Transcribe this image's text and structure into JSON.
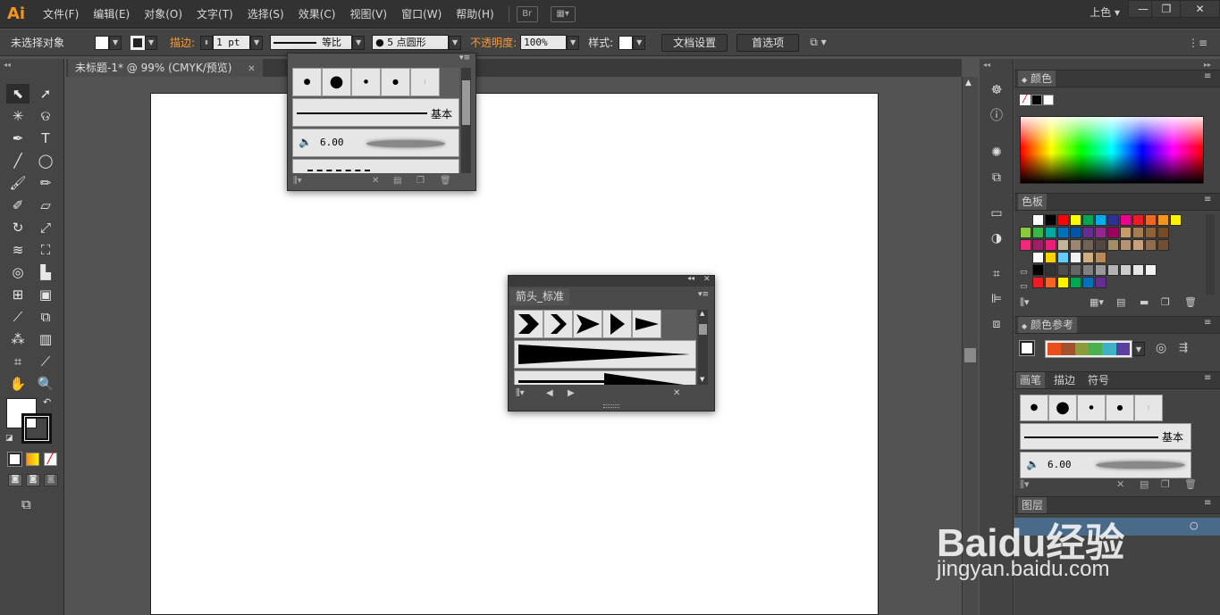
{
  "app": {
    "logo": "Ai"
  },
  "menu": [
    "文件(F)",
    "编辑(E)",
    "对象(O)",
    "文字(T)",
    "选择(S)",
    "效果(C)",
    "视图(V)",
    "窗口(W)",
    "帮助(H)"
  ],
  "menubar": {
    "bridge_label": "Br",
    "workspace": "上色"
  },
  "control": {
    "selection": "未选择对象",
    "stroke_label": "描边:",
    "stroke_weight": "1 pt",
    "profile": "等比",
    "brush": "5 点圆形",
    "opacity_label": "不透明度:",
    "opacity": "100%",
    "style_label": "样式:",
    "doc_setup": "文档设置",
    "preferences": "首选项"
  },
  "document": {
    "tab_title": "未标题-1* @ 99% (CMYK/预览)"
  },
  "brush_popup": {
    "line_label": "基本",
    "brush_size": "6.00"
  },
  "arrow_panel": {
    "title": "箭头_标准"
  },
  "panels": {
    "color": {
      "title": "颜色"
    },
    "swatches": {
      "title": "色板"
    },
    "color_guide": {
      "title": "颜色参考"
    },
    "brushes": {
      "tabs": [
        "画笔",
        "描边",
        "符号"
      ],
      "line_label": "基本",
      "brush_size": "6.00"
    },
    "layers": {
      "title": "图层"
    }
  },
  "swatch_colors": [
    [
      "#ffffff",
      "#000000",
      "#ff0000",
      "#ffff00",
      "#00a651",
      "#00aeef",
      "#2e3192",
      "#ec008c",
      "#ed1c24",
      "#f26522",
      "#f7941d",
      "#fff200"
    ],
    [
      "#8dc63f",
      "#39b54a",
      "#00a99d",
      "#0072bc",
      "#0054a6",
      "#662d91",
      "#92278f",
      "#9e005d",
      "#c69c6d",
      "#a67c52",
      "#8c6239",
      "#754c24"
    ],
    [
      "#ee2b7b",
      "#9e1f63",
      "#ed1e79",
      "#c2b59b",
      "#998675",
      "#736357",
      "#534741",
      "#a38e6a",
      "#b59475",
      "#c7a07e",
      "#8e6e4f",
      "#6e5034"
    ],
    [
      "#ffffff",
      "#ffd200",
      "#66ccff",
      "#f2f2f2",
      "#cfae80",
      "#b88a5a"
    ],
    [
      "#000000",
      "#333333",
      "#4d4d4d",
      "#666666",
      "#808080",
      "#999999",
      "#b3b3b3",
      "#cccccc",
      "#e6e6e6",
      "#f2f2f2"
    ],
    [
      "#ed1c24",
      "#f26522",
      "#fff200",
      "#00a651",
      "#0072bc",
      "#662d91"
    ]
  ],
  "color_guide_swatches": [
    "#e84f1c",
    "#a0522d",
    "#8b9c3a",
    "#4caf50",
    "#3fb1c4",
    "#5b3fa0"
  ],
  "watermark": {
    "line1": "Baidu经验",
    "line2": "jingyan.baidu.com"
  }
}
